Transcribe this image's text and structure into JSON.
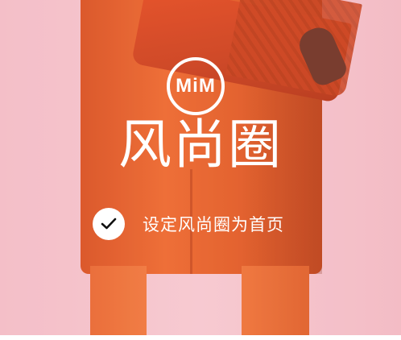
{
  "brand": {
    "logo_text": "MiM",
    "title": "风尚圈"
  },
  "homepage_option": {
    "label": "设定风尚圈为首页",
    "checked": true,
    "check_icon": "checkmark-icon"
  },
  "colors": {
    "background_pink": "#f4c7cf",
    "coat_orange": "#e35f24",
    "text_white": "#ffffff",
    "check_black": "#111111"
  }
}
